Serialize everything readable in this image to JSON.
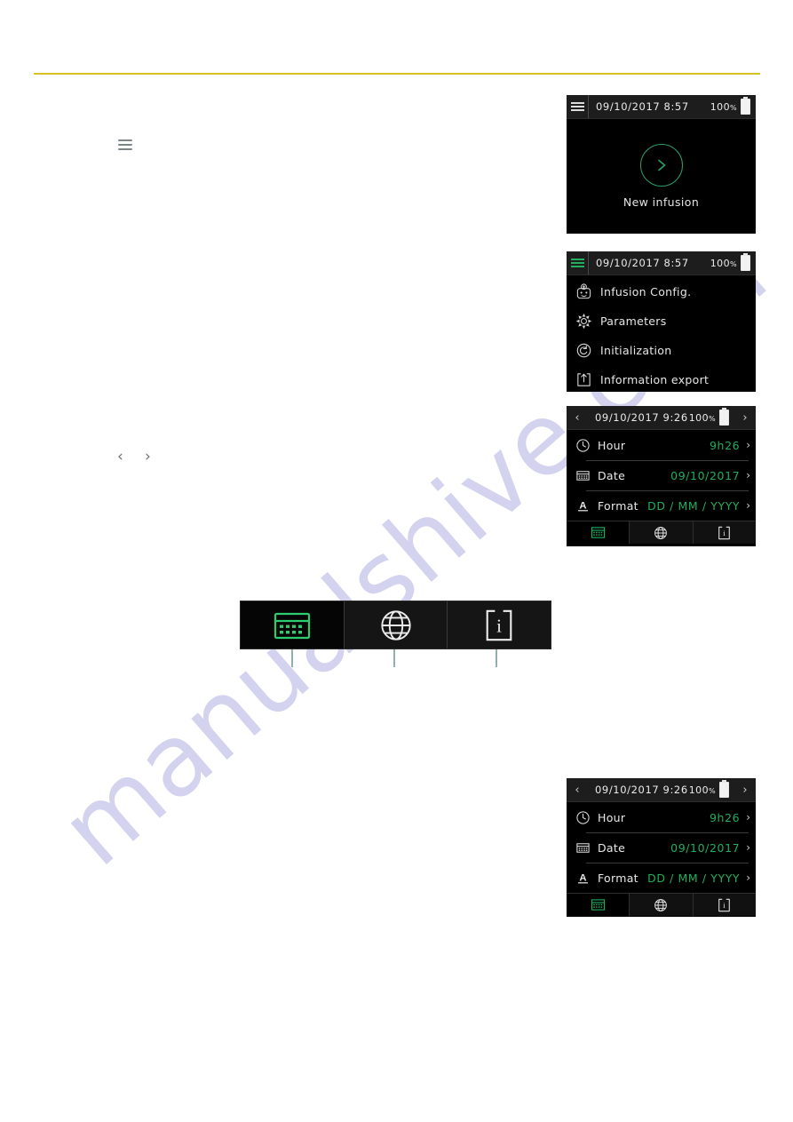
{
  "page": {
    "watermark_text": "manualshive.com",
    "rule_color": "#d8c21f",
    "accent_green": "#1faf5c",
    "leader_color": "#8fb1ad"
  },
  "body_marks": {
    "hamburger_icon": "hamburger-icon",
    "chevron_left": "‹",
    "chevron_right": "›"
  },
  "screens": {
    "home": {
      "statusbar": {
        "menu_icon": "hamburger-icon",
        "datetime": "09/10/2017  8:57",
        "battery_percent": "100",
        "battery_percent_unit": "%",
        "battery_icon": "battery-full-icon"
      },
      "action_icon": "play-chevron-icon",
      "action_label": "New infusion"
    },
    "menu": {
      "statusbar": {
        "menu_icon": "hamburger-icon-green",
        "datetime": "09/10/2017  8:57",
        "battery_percent": "100",
        "battery_percent_unit": "%",
        "battery_icon": "battery-full-icon"
      },
      "items": [
        {
          "icon": "infusion-pump-icon",
          "label": "Infusion Config."
        },
        {
          "icon": "gear-icon",
          "label": "Parameters"
        },
        {
          "icon": "reset-circular-arrow-icon",
          "label": "Initialization"
        },
        {
          "icon": "export-upload-icon",
          "label": "Information export"
        }
      ]
    },
    "date_settings": {
      "statusbar": {
        "back_icon": "chevron-left-icon",
        "datetime": "09/10/2017  9:26",
        "battery_percent": "100",
        "battery_percent_unit": "%",
        "battery_icon": "battery-full-icon",
        "forward_icon": "chevron-right-icon"
      },
      "rows": [
        {
          "icon": "clock-icon",
          "label": "Hour",
          "value": "9h26",
          "chevron": "›"
        },
        {
          "icon": "calendar-icon",
          "label": "Date",
          "value": "09/10/2017",
          "chevron": "›"
        },
        {
          "icon": "font-a-icon",
          "label": "Format",
          "value": "DD / MM / YYYY",
          "chevron": "›"
        }
      ],
      "tabs": [
        {
          "icon": "calendar-icon",
          "name": "tab-date",
          "active": true
        },
        {
          "icon": "globe-icon",
          "name": "tab-language",
          "active": false
        },
        {
          "icon": "info-page-icon",
          "name": "tab-info",
          "active": false
        }
      ]
    }
  },
  "callout_tabbar": {
    "tabs": [
      {
        "icon": "calendar-icon",
        "name": "tab-date",
        "active": true
      },
      {
        "icon": "globe-icon",
        "name": "tab-language",
        "active": false
      },
      {
        "icon": "info-page-icon",
        "name": "tab-info",
        "active": false
      }
    ],
    "leader_count": 3
  }
}
